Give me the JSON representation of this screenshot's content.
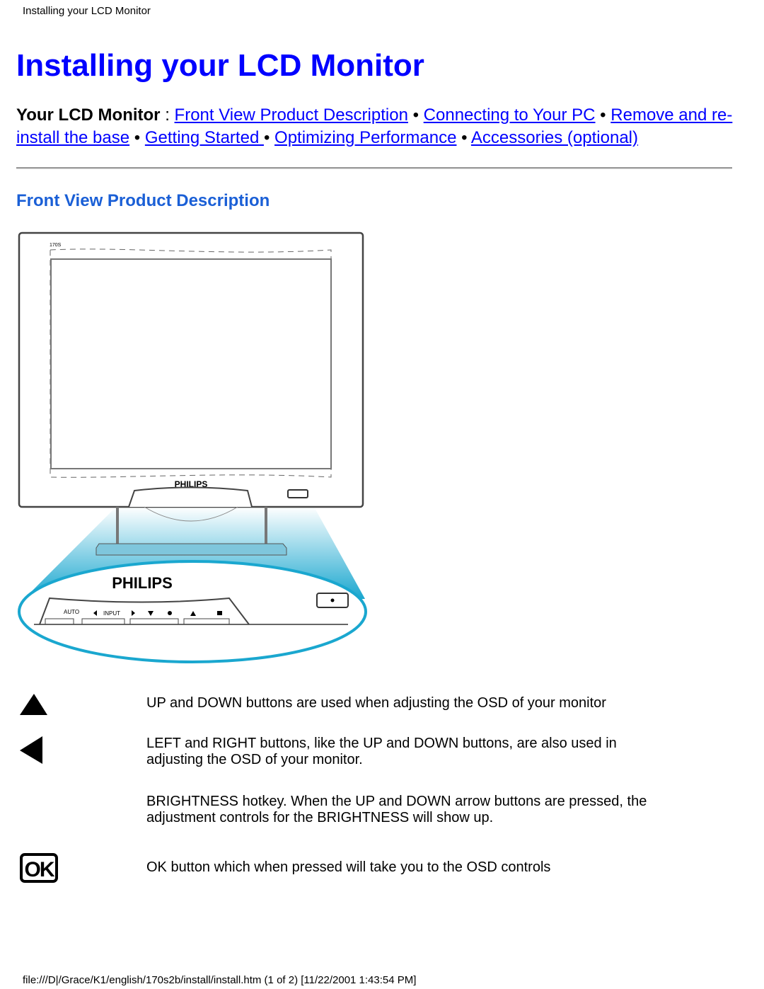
{
  "header": {
    "title": "Installing your LCD Monitor"
  },
  "page_title": "Installing your LCD Monitor",
  "nav": {
    "label": "Your LCD Monitor",
    "separator": " : ",
    "bullet": " • ",
    "links": [
      "Front View Product Description",
      "Connecting to Your PC",
      "Remove and re-install the base",
      "Getting Started ",
      "Optimizing Performance",
      "Accessories (optional)"
    ]
  },
  "section": {
    "title": "Front View Product Description"
  },
  "illustration": {
    "brand_logo": "PHILIPS",
    "model_label": "170S",
    "button_labels": [
      "AUTO",
      "INPUT"
    ],
    "accent_color": "#1aa7cf"
  },
  "rows": [
    {
      "icon": "up-triangle-icon",
      "text": "UP and DOWN buttons are used when adjusting the OSD of your monitor"
    },
    {
      "icon": "left-triangle-icon",
      "text": "LEFT and RIGHT buttons, like the UP and DOWN buttons, are also used in adjusting the OSD of your monitor."
    },
    {
      "icon": "",
      "text": "BRIGHTNESS hotkey. When the UP and DOWN arrow buttons are pressed, the adjustment controls for the BRIGHTNESS will show up."
    },
    {
      "icon": "ok-button-icon",
      "text": "OK button which when pressed will take you to the OSD controls"
    }
  ],
  "footer": {
    "text": "file:///D|/Grace/K1/english/170s2b/install/install.htm (1 of 2) [11/22/2001 1:43:54 PM]"
  }
}
